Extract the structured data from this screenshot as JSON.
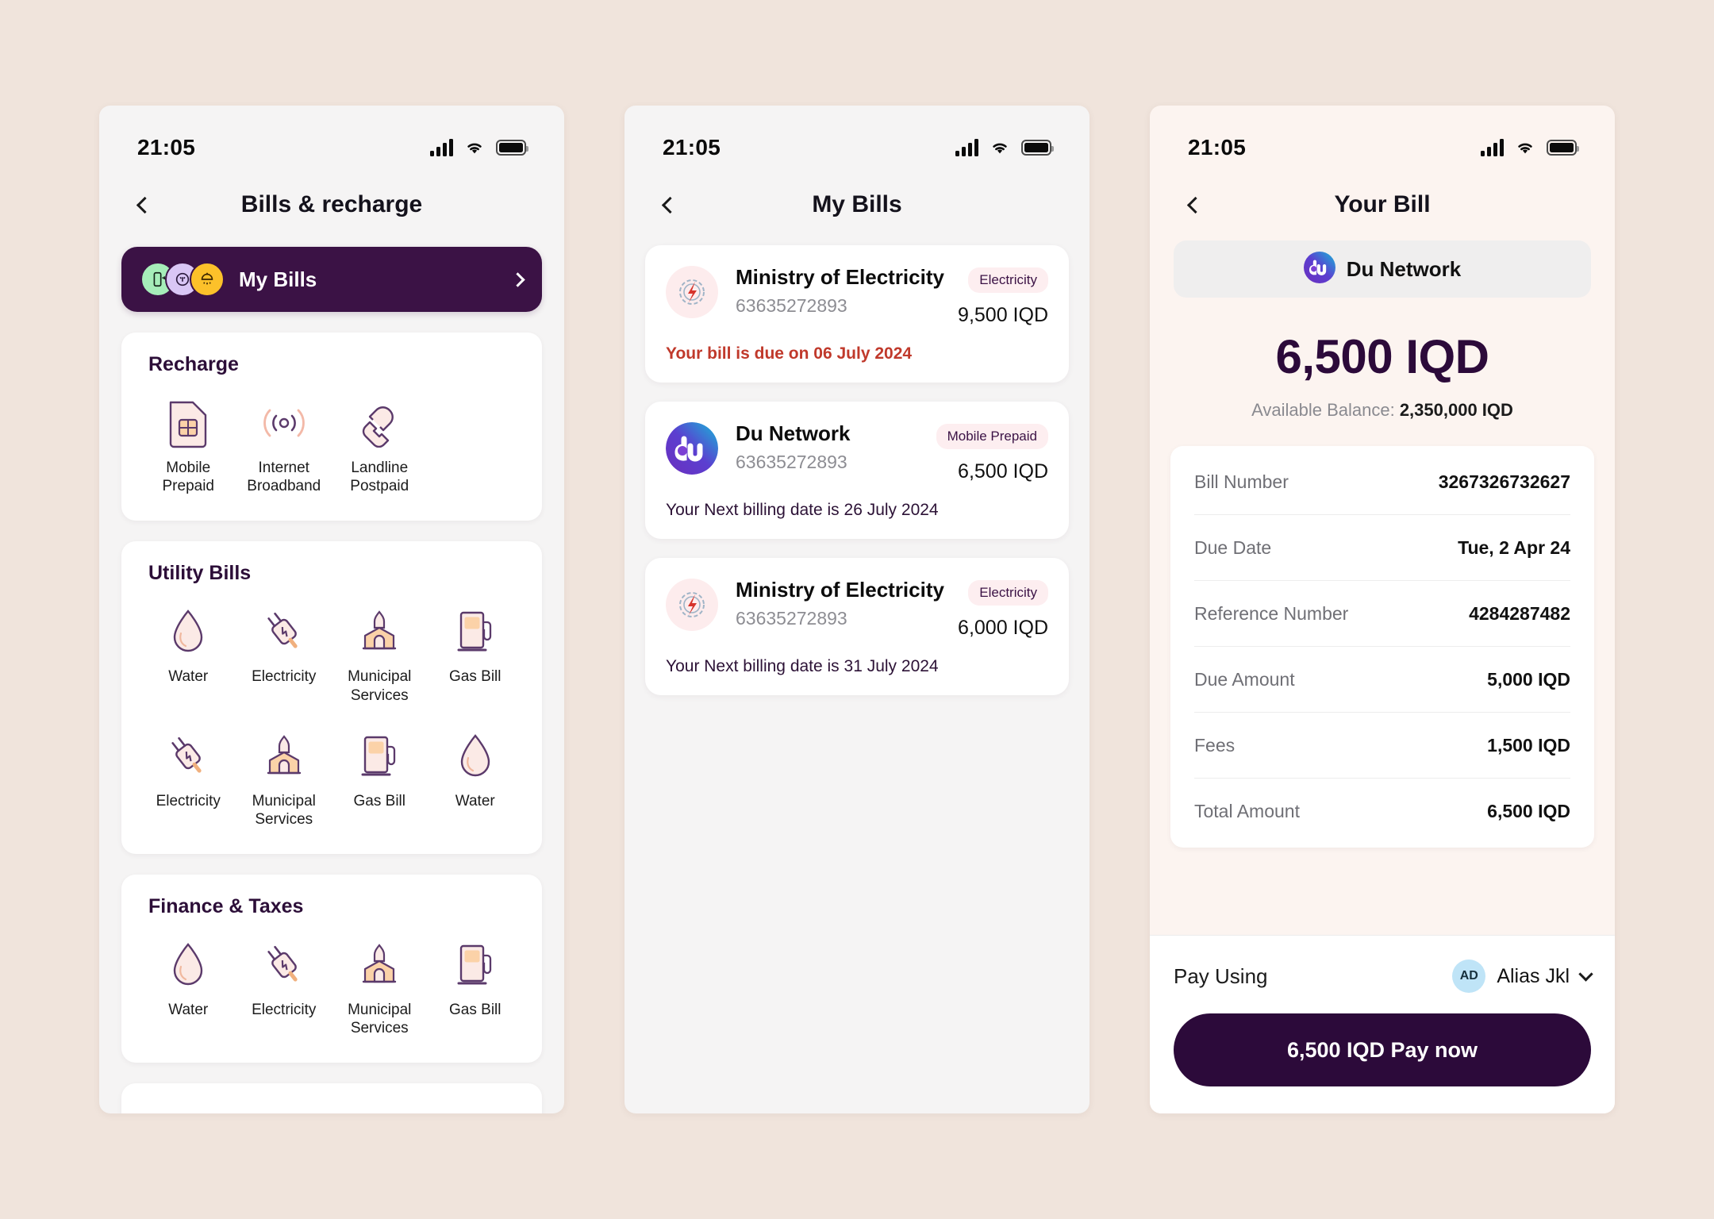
{
  "status_bar": {
    "time": "21:05"
  },
  "screen1": {
    "nav_title": "Bills & recharge",
    "back_icon": "chevron-left-icon",
    "my_bills": {
      "label": "My Bills",
      "chevron": "chevron-right-icon",
      "avatars": [
        "mobile-icon",
        "plug-icon",
        "shower-icon"
      ]
    },
    "sections": [
      {
        "title": "Recharge",
        "columns": 4,
        "tiles": [
          {
            "label": "Mobile\nPrepaid",
            "icon": "sim-card-icon"
          },
          {
            "label": "Internet\nBroadband",
            "icon": "wifi-signal-icon"
          },
          {
            "label": "Landline\nPostpaid",
            "icon": "telephone-handset-icon"
          }
        ]
      },
      {
        "title": "Utility Bills",
        "columns": 4,
        "tiles": [
          {
            "label": "Water",
            "icon": "water-drop-icon"
          },
          {
            "label": "Electricity",
            "icon": "plug-icon"
          },
          {
            "label": "Municipal\nServices",
            "icon": "municipal-building-icon"
          },
          {
            "label": "Gas Bill",
            "icon": "gas-pump-icon"
          },
          {
            "label": "Electricity",
            "icon": "plug-icon"
          },
          {
            "label": "Municipal\nServices",
            "icon": "municipal-building-icon"
          },
          {
            "label": "Gas Bill",
            "icon": "gas-pump-icon"
          },
          {
            "label": "Water",
            "icon": "water-drop-icon"
          }
        ]
      },
      {
        "title": "Finance & Taxes",
        "columns": 4,
        "tiles": [
          {
            "label": "Water",
            "icon": "water-drop-icon"
          },
          {
            "label": "Electricity",
            "icon": "plug-icon"
          },
          {
            "label": "Municipal\nServices",
            "icon": "municipal-building-icon"
          },
          {
            "label": "Gas Bill",
            "icon": "gas-pump-icon"
          }
        ]
      }
    ]
  },
  "screen2": {
    "nav_title": "My Bills",
    "back_icon": "chevron-left-icon",
    "bills": [
      {
        "name": "Ministry of Electricity",
        "account": "63635272893",
        "tag": "Electricity",
        "amount": "9,500 IQD",
        "note": "Your bill is due on 06 July 2024",
        "note_type": "due",
        "logo": "ministry-of-electricity-logo"
      },
      {
        "name": "Du Network",
        "account": "63635272893",
        "tag": "Mobile Prepaid",
        "amount": "6,500 IQD",
        "note": "Your Next billing date is 26 July 2024",
        "note_type": "next",
        "logo": "du-network-logo"
      },
      {
        "name": "Ministry of Electricity",
        "account": "63635272893",
        "tag": "Electricity",
        "amount": "6,000 IQD",
        "note": "Your Next billing date is 31 July 2024",
        "note_type": "next",
        "logo": "ministry-of-electricity-logo"
      }
    ]
  },
  "screen3": {
    "nav_title": "Your Bill",
    "back_icon": "chevron-left-icon",
    "biller": {
      "name": "Du Network",
      "logo": "du-network-logo"
    },
    "amount": "6,500 IQD",
    "available_balance_label": "Available Balance:",
    "available_balance_value": "2,350,000 IQD",
    "details": [
      {
        "label": "Bill Number",
        "value": "3267326732627"
      },
      {
        "label": "Due Date",
        "value": "Tue, 2 Apr 24"
      },
      {
        "label": "Reference Number",
        "value": "4284287482"
      },
      {
        "label": "Due Amount",
        "value": "5,000 IQD"
      },
      {
        "label": "Fees",
        "value": "1,500 IQD"
      },
      {
        "label": "Total Amount",
        "value": "6,500 IQD"
      }
    ],
    "pay_using": {
      "label": "Pay Using",
      "account_initials": "AD",
      "account_name": "Alias Jkl",
      "chevron": "chevron-down-icon"
    },
    "pay_button": "6,500 IQD Pay now"
  },
  "colors": {
    "page_bg": "#f0e4dc",
    "brand_dark": "#2c0a3a",
    "banner": "#3b1245",
    "due_red": "#c0392b",
    "tag_bg": "#fdeef0",
    "icon_outline": "#5b3a6b",
    "icon_fill_peach": "#fbd2a8",
    "icon_fill_pink": "#fbeaea"
  }
}
